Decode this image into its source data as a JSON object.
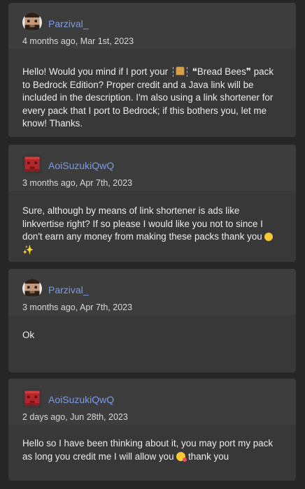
{
  "comments": [
    {
      "username": "Parzival_",
      "timestamp": "4 months ago, Mar 1st, 2023",
      "avatar_icon": "pixel-bearded-man-avatar",
      "text_before": "Hello! Would you mind if I port your",
      "emoji1": "bread-emoji",
      "text_after": "❝Bread Bees❞ pack to Bedrock Edition? Proper credit and a Java link will be included in the description. I'm also using a link shortener for every pack that I port to Bedrock; if this bothers you, let me know! Thanks."
    },
    {
      "username": "AoiSuzukiQwQ",
      "timestamp": "3 months ago, Apr 7th, 2023",
      "avatar_icon": "pixel-red-block-avatar",
      "text": "Sure, although by means of link shortener is ads like linkvertise right? If so please I would like you not to since I don't earn any money from making these packs thank you"
    },
    {
      "username": "Parzival_",
      "timestamp": "3 months ago, Apr 7th, 2023",
      "avatar_icon": "pixel-bearded-man-avatar",
      "text": "Ok"
    },
    {
      "username": "AoiSuzukiQwQ",
      "timestamp": "2 days ago, Jun 28th, 2023",
      "avatar_icon": "pixel-red-block-avatar",
      "text_before": "Hello so I have been thinking about it, you may port my pack as long you credit me I will allow you",
      "text_after": "thank you"
    }
  ],
  "colors": {
    "username": "#7b9be6",
    "card": "#383838",
    "header": "#3d3d3d",
    "background": "#262626"
  }
}
